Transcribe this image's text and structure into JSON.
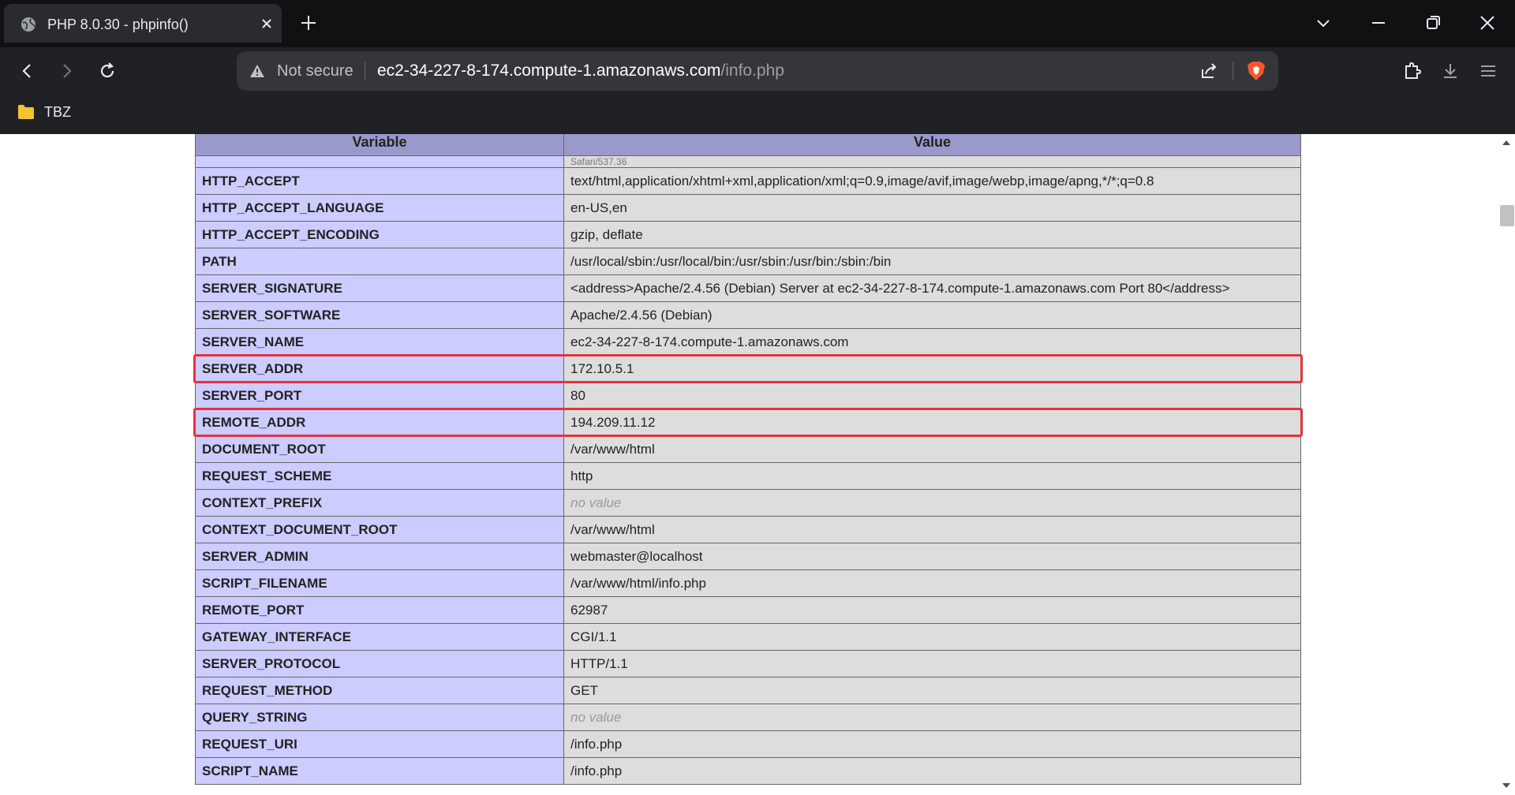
{
  "browser": {
    "tab": {
      "title": "PHP 8.0.30 - phpinfo()"
    },
    "address_bar": {
      "security_label": "Not secure",
      "url_host": "ec2-34-227-8-174.compute-1.amazonaws.com",
      "url_path": "/info.php"
    },
    "bookmarks": [
      {
        "label": "TBZ"
      }
    ],
    "icons": [
      "globe-icon",
      "close-icon",
      "plus-icon",
      "chevron-down-icon",
      "minimize-icon",
      "restore-icon",
      "window-close-icon",
      "back-icon",
      "forward-icon",
      "reload-icon",
      "warning-icon",
      "share-icon",
      "brave-shield-icon",
      "extensions-icon",
      "download-icon",
      "menu-icon",
      "folder-icon"
    ]
  },
  "table": {
    "headers": {
      "variable": "Variable",
      "value": "Value"
    },
    "partial_row_value": "Safari/537.36",
    "rows": [
      {
        "name": "HTTP_ACCEPT",
        "value": "text/html,application/xhtml+xml,application/xml;q=0.9,image/avif,image/webp,image/apng,*/*;q=0.8"
      },
      {
        "name": "HTTP_ACCEPT_LANGUAGE",
        "value": "en-US,en"
      },
      {
        "name": "HTTP_ACCEPT_ENCODING",
        "value": "gzip, deflate"
      },
      {
        "name": "PATH",
        "value": "/usr/local/sbin:/usr/local/bin:/usr/sbin:/usr/bin:/sbin:/bin"
      },
      {
        "name": "SERVER_SIGNATURE",
        "value": "<address>Apache/2.4.56 (Debian) Server at ec2-34-227-8-174.compute-1.amazonaws.com Port 80</address>"
      },
      {
        "name": "SERVER_SOFTWARE",
        "value": "Apache/2.4.56 (Debian)"
      },
      {
        "name": "SERVER_NAME",
        "value": "ec2-34-227-8-174.compute-1.amazonaws.com"
      },
      {
        "name": "SERVER_ADDR",
        "value": "172.10.5.1",
        "highlighted": true
      },
      {
        "name": "SERVER_PORT",
        "value": "80"
      },
      {
        "name": "REMOTE_ADDR",
        "value": "194.209.11.12",
        "highlighted": true
      },
      {
        "name": "DOCUMENT_ROOT",
        "value": "/var/www/html"
      },
      {
        "name": "REQUEST_SCHEME",
        "value": "http"
      },
      {
        "name": "CONTEXT_PREFIX",
        "value": "no value",
        "no_value": true
      },
      {
        "name": "CONTEXT_DOCUMENT_ROOT",
        "value": "/var/www/html"
      },
      {
        "name": "SERVER_ADMIN",
        "value": "webmaster@localhost"
      },
      {
        "name": "SCRIPT_FILENAME",
        "value": "/var/www/html/info.php"
      },
      {
        "name": "REMOTE_PORT",
        "value": "62987"
      },
      {
        "name": "GATEWAY_INTERFACE",
        "value": "CGI/1.1"
      },
      {
        "name": "SERVER_PROTOCOL",
        "value": "HTTP/1.1"
      },
      {
        "name": "REQUEST_METHOD",
        "value": "GET"
      },
      {
        "name": "QUERY_STRING",
        "value": "no value",
        "no_value": true
      },
      {
        "name": "REQUEST_URI",
        "value": "/info.php"
      },
      {
        "name": "SCRIPT_NAME",
        "value": "/info.php"
      }
    ]
  },
  "colors": {
    "header_bg": "#9999cc",
    "name_cell_bg": "#ccccff",
    "value_cell_bg": "#dddddd",
    "highlight_border": "#e0343f"
  }
}
